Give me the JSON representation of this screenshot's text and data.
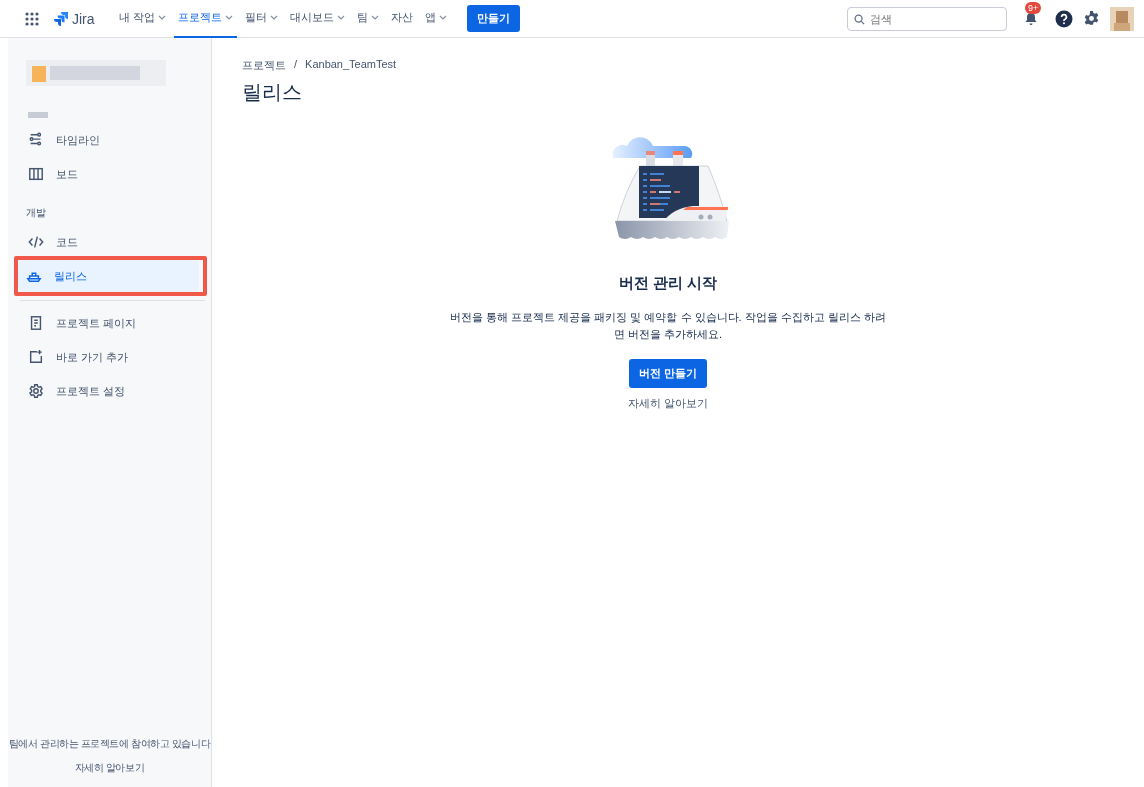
{
  "topbar": {
    "logo": "Jira",
    "nav": [
      {
        "label": "내 작업",
        "has_menu": true,
        "selected": false
      },
      {
        "label": "프로젝트",
        "has_menu": true,
        "selected": true
      },
      {
        "label": "필터",
        "has_menu": true,
        "selected": false
      },
      {
        "label": "대시보드",
        "has_menu": true,
        "selected": false
      },
      {
        "label": "팀",
        "has_menu": true,
        "selected": false
      },
      {
        "label": "자산",
        "has_menu": false,
        "selected": false
      },
      {
        "label": "앱",
        "has_menu": true,
        "selected": false
      }
    ],
    "create_button": "만들기",
    "search": {
      "placeholder": "검색"
    },
    "notification_badge": "9+"
  },
  "sidebar": {
    "groups": [
      {
        "items": [
          {
            "label": "타임라인",
            "selected": false
          },
          {
            "label": "보드",
            "selected": false
          }
        ]
      },
      {
        "heading": "개발",
        "items": [
          {
            "label": "코드",
            "selected": false
          },
          {
            "label": "릴리스",
            "selected": true
          }
        ]
      },
      {
        "items": [
          {
            "label": "프로젝트 페이지",
            "selected": false
          },
          {
            "label": "바로 가기 추가",
            "selected": false
          },
          {
            "label": "프로젝트 설정",
            "selected": false
          }
        ]
      }
    ],
    "footer_text": "팀에서 관리하는 프로젝트에 참여하고 있습니다",
    "footer_link": "자세히 알아보기"
  },
  "breadcrumbs": {
    "items": [
      "프로젝트",
      "Kanban_TeamTest"
    ],
    "separator": "/"
  },
  "page_title": "릴리스",
  "empty_state": {
    "title": "버전 관리 시작",
    "description": "버전을 통해 프로젝트 제공을 패키징 및 예약할 수 있습니다. 작업을 수집하고 릴리스 하려면 버전을 추가하세요.",
    "button": "버전 만들기",
    "link": "자세히 알아보기"
  }
}
